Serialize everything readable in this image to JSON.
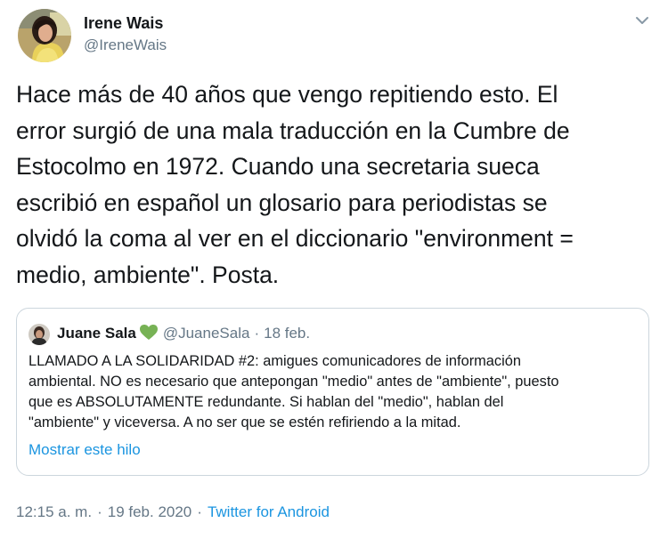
{
  "tweet": {
    "author_name": "Irene Wais",
    "author_handle": "@IreneWais",
    "text": "Hace más de 40 años que vengo repitiendo esto. El\nerror surgió de una mala traducción en la Cumbre de\nEstocolmo en 1972. Cuando una secretaria sueca\nescribió en español un glosario para periodistas se\nolvidó la coma al ver en el diccionario \"environment =\nmedio, ambiente\". Posta.",
    "time": "12:15 a. m.",
    "separator": "·",
    "date": "19 feb. 2020",
    "source": "Twitter for Android"
  },
  "quoted_tweet": {
    "author_name": "Juane Sala",
    "author_handle": "@JuaneSala",
    "separator": "·",
    "date": "18 feb.",
    "text": "LLAMADO A LA SOLIDARIDAD #2: amigues comunicadores de información\nambiental. NO es necesario que antepongan \"medio\" antes de \"ambiente\", puesto\nque es ABSOLUTAMENTE redundante. Si hablan del \"medio\", hablan del\n\"ambiente\" y viceversa. A no ser que se estén refiriendo a la mitad.",
    "show_thread_label": "Mostrar este hilo"
  },
  "icons": {
    "menu": "chevron-down-icon",
    "heart": "green-heart-emoji"
  },
  "colors": {
    "text": "#14171a",
    "secondary": "#657786",
    "link": "#1b95e0",
    "border": "#ccd6dd",
    "heart": "#77b255"
  }
}
